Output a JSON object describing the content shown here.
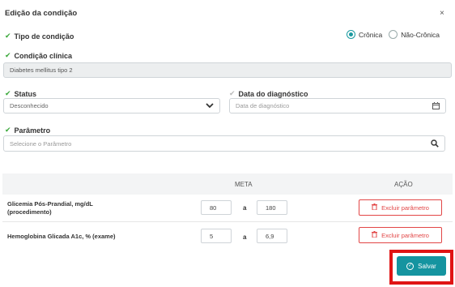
{
  "modal": {
    "title": "Edição da condição",
    "close_glyph": "×"
  },
  "tipo": {
    "label": "Tipo de condição",
    "options": [
      {
        "label": "Crônica",
        "selected": true
      },
      {
        "label": "Não-Crônica",
        "selected": false
      }
    ]
  },
  "condicao": {
    "label": "Condição clínica",
    "value": "Diabetes mellitus tipo 2"
  },
  "status": {
    "label": "Status",
    "value": "Desconhecido"
  },
  "diagnostico": {
    "label": "Data do diagnóstico",
    "placeholder": "Data de diagnóstico"
  },
  "parametro": {
    "label": "Parâmetro",
    "placeholder": "Selecione o Parâmetro"
  },
  "table": {
    "headers": {
      "meta": "META",
      "acao": "AÇÃO"
    },
    "separator": "a",
    "delete_label": "Excluir parâmetro",
    "rows": [
      {
        "name_line1": "Glicemia Pós-Prandial, mg/dL",
        "name_line2": "(procedimento)",
        "min": "80",
        "max": "180"
      },
      {
        "name_line1": "Hemoglobina Glicada A1c, % (exame)",
        "name_line2": "",
        "min": "5",
        "max": "6,9"
      }
    ]
  },
  "save": {
    "label": "Salvar"
  },
  "colors": {
    "accent": "#1594a0",
    "check": "#3aa83a",
    "danger": "#e24646",
    "highlight": "#e01414"
  },
  "icons": {
    "check": "check-icon",
    "chevron": "chevron-down-icon",
    "calendar": "calendar-icon",
    "search": "search-icon",
    "trash": "trash-icon",
    "save": "check-circle-icon",
    "close": "close-icon"
  }
}
